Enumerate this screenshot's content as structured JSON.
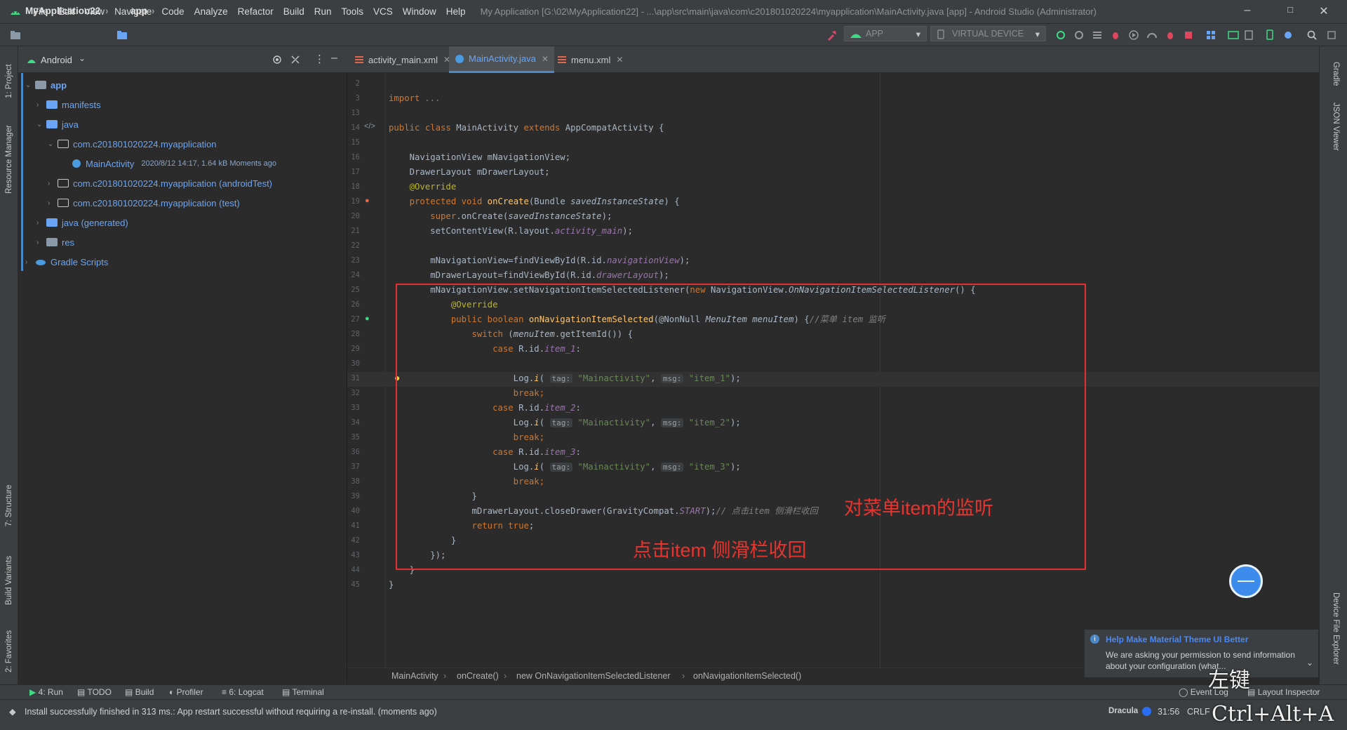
{
  "menubar": {
    "items": [
      "File",
      "Edit",
      "View",
      "Navigate",
      "Code",
      "Analyze",
      "Refactor",
      "Build",
      "Run",
      "Tools",
      "VCS",
      "Window",
      "Help"
    ],
    "title": "My Application [G:\\02\\MyApplication22] - ...\\app\\src\\main\\java\\com\\c201801020224\\myapplication\\MainActivity.java [app] - Android Studio (Administrator)"
  },
  "navbar": {
    "project": "MyApplication22",
    "module": "app",
    "run_config": "APP",
    "device": "VIRTUAL DEVICE"
  },
  "left_strip": {
    "project": "1: Project",
    "resource_manager": "Resource Manager",
    "structure": "7: Structure",
    "build_variants": "Build Variants",
    "favorites": "2: Favorites"
  },
  "project_panel": {
    "view": "Android",
    "tree": [
      {
        "label": "app",
        "level": 0,
        "bold": true
      },
      {
        "label": "manifests",
        "level": 1
      },
      {
        "label": "java",
        "level": 1
      },
      {
        "label": "com.c201801020224.myapplication",
        "level": 2
      },
      {
        "label": "MainActivity",
        "level": 3,
        "meta": "2020/8/12 14:17, 1.64 kB  Moments ago"
      },
      {
        "label": "com.c201801020224.myapplication (androidTest)",
        "level": 2
      },
      {
        "label": "com.c201801020224.myapplication (test)",
        "level": 2
      },
      {
        "label": "java (generated)",
        "level": 1
      },
      {
        "label": "res",
        "level": 1
      },
      {
        "label": "Gradle Scripts",
        "level": 0
      }
    ]
  },
  "tabs": [
    {
      "label": "activity_main.xml",
      "active": false
    },
    {
      "label": "MainActivity.java",
      "active": true
    },
    {
      "label": "menu.xml",
      "active": false
    }
  ],
  "line_numbers": [
    "2",
    "3",
    "13",
    "14",
    "15",
    "16",
    "17",
    "18",
    "19",
    "20",
    "21",
    "22",
    "23",
    "24",
    "25",
    "26",
    "27",
    "28",
    "29",
    "30",
    "31",
    "32",
    "33",
    "34",
    "35",
    "36",
    "37",
    "38",
    "39",
    "40",
    "41",
    "42",
    "43",
    "44",
    "45"
  ],
  "code": {
    "l2": "",
    "l3_kw": "import",
    "l3_rest": " ...",
    "l14_a": "public class ",
    "l14_b": "MainActivity ",
    "l14_c": "extends ",
    "l14_d": "AppCompatActivity {",
    "l16": "    NavigationView mNavigationView;",
    "l17": "    DrawerLayout mDrawerLayout;",
    "l18": "    @Override",
    "l19_a": "    protected void ",
    "l19_b": "onCreate",
    "l19_c": "(Bundle ",
    "l19_d": "savedInstanceState",
    "l19_e": ") {",
    "l20_a": "        super",
    "l20_b": ".onCreate(",
    "l20_c": "savedInstanceState",
    "l20_d": ");",
    "l21_a": "        setContentView(R.layout.",
    "l21_b": "activity_main",
    "l21_c": ");",
    "l23_a": "        mNavigationView=findViewById(R.id.",
    "l23_b": "navigationView",
    "l23_c": ");",
    "l24_a": "        mDrawerLayout=findViewById(R.id.",
    "l24_b": "drawerLayout",
    "l24_c": ");",
    "l25_a": "        mNavigationView.setNavigationItemSelectedListener(",
    "l25_b": "new ",
    "l25_c": "NavigationView.",
    "l25_d": "OnNavigationItemSelectedListener",
    "l25_e": "() {",
    "l26": "            @Override",
    "l27_a": "            public boolean ",
    "l27_b": "onNavigationItemSelected",
    "l27_c": "(@NonNull ",
    "l27_d": "MenuItem menuItem",
    "l27_e": ") {",
    "l27_f": "//菜单 item 监听",
    "l28_a": "                switch ",
    "l28_b": "(",
    "l28_c": "menuItem",
    "l28_d": ".getItemId()) {",
    "l29_a": "                    case ",
    "l29_b": "R.id.",
    "l29_c": "item_1",
    "l29_d": ":",
    "log_a": "                        Log.",
    "log_b": "i",
    "log_c": "( ",
    "hint_tag": "tag:",
    "log_str1": "\"Mainactivity\"",
    "log_comma": ", ",
    "hint_msg": "msg:",
    "item1_str": "\"item_1\"",
    "item2_str": "\"item_2\"",
    "item3_str": "\"item_3\"",
    "log_end": ");",
    "break": "                        break;",
    "case_kw": "                    case ",
    "case_rid": "R.id.",
    "item_2": "item_2",
    "item_3": "item_3",
    "colon": ":",
    "l39": "                }",
    "l40_a": "                mDrawerLayout.closeDrawer(GravityCompat.",
    "l40_b": "START",
    "l40_c": ");",
    "l40_d": "// 点击item 侧滑栏收回",
    "l41_a": "                return ",
    "l41_b": "true",
    "l41_c": ";",
    "l42": "            }",
    "l43": "        });",
    "l44": "    }",
    "l45": "}"
  },
  "annotations": {
    "menu_listener": "对菜单item的监听",
    "collapse_drawer": "点击item 侧滑栏收回"
  },
  "editor_crumbs": [
    "MainActivity",
    "onCreate()",
    "new OnNavigationItemSelectedListener",
    "onNavigationItemSelected()"
  ],
  "bottom_tabs": [
    "4: Run",
    "TODO",
    "Build",
    "Profiler",
    "6: Logcat",
    "Terminal",
    "Event Log",
    "Layout Inspector"
  ],
  "right_strip": {
    "gradle": "Gradle",
    "json_viewer": "JSON Viewer",
    "device_explorer": "Device File Explorer"
  },
  "notification": {
    "title": "Help Make Material Theme UI Better",
    "body": "We are asking your permission to send information about your configuration (what..."
  },
  "status": {
    "message": "Install successfully finished in 313 ms.: App restart successful without requiring a re-install. (moments ago)",
    "theme": "Dracula",
    "position": "31:56",
    "line_sep": "CRLF"
  },
  "overlay": {
    "click_label": "左键",
    "shortcut": "Ctrl+Alt+A"
  },
  "colors": {
    "accent_red": "#e03030",
    "android_green": "#3ddc84",
    "link_blue": "#6aa5f5"
  }
}
